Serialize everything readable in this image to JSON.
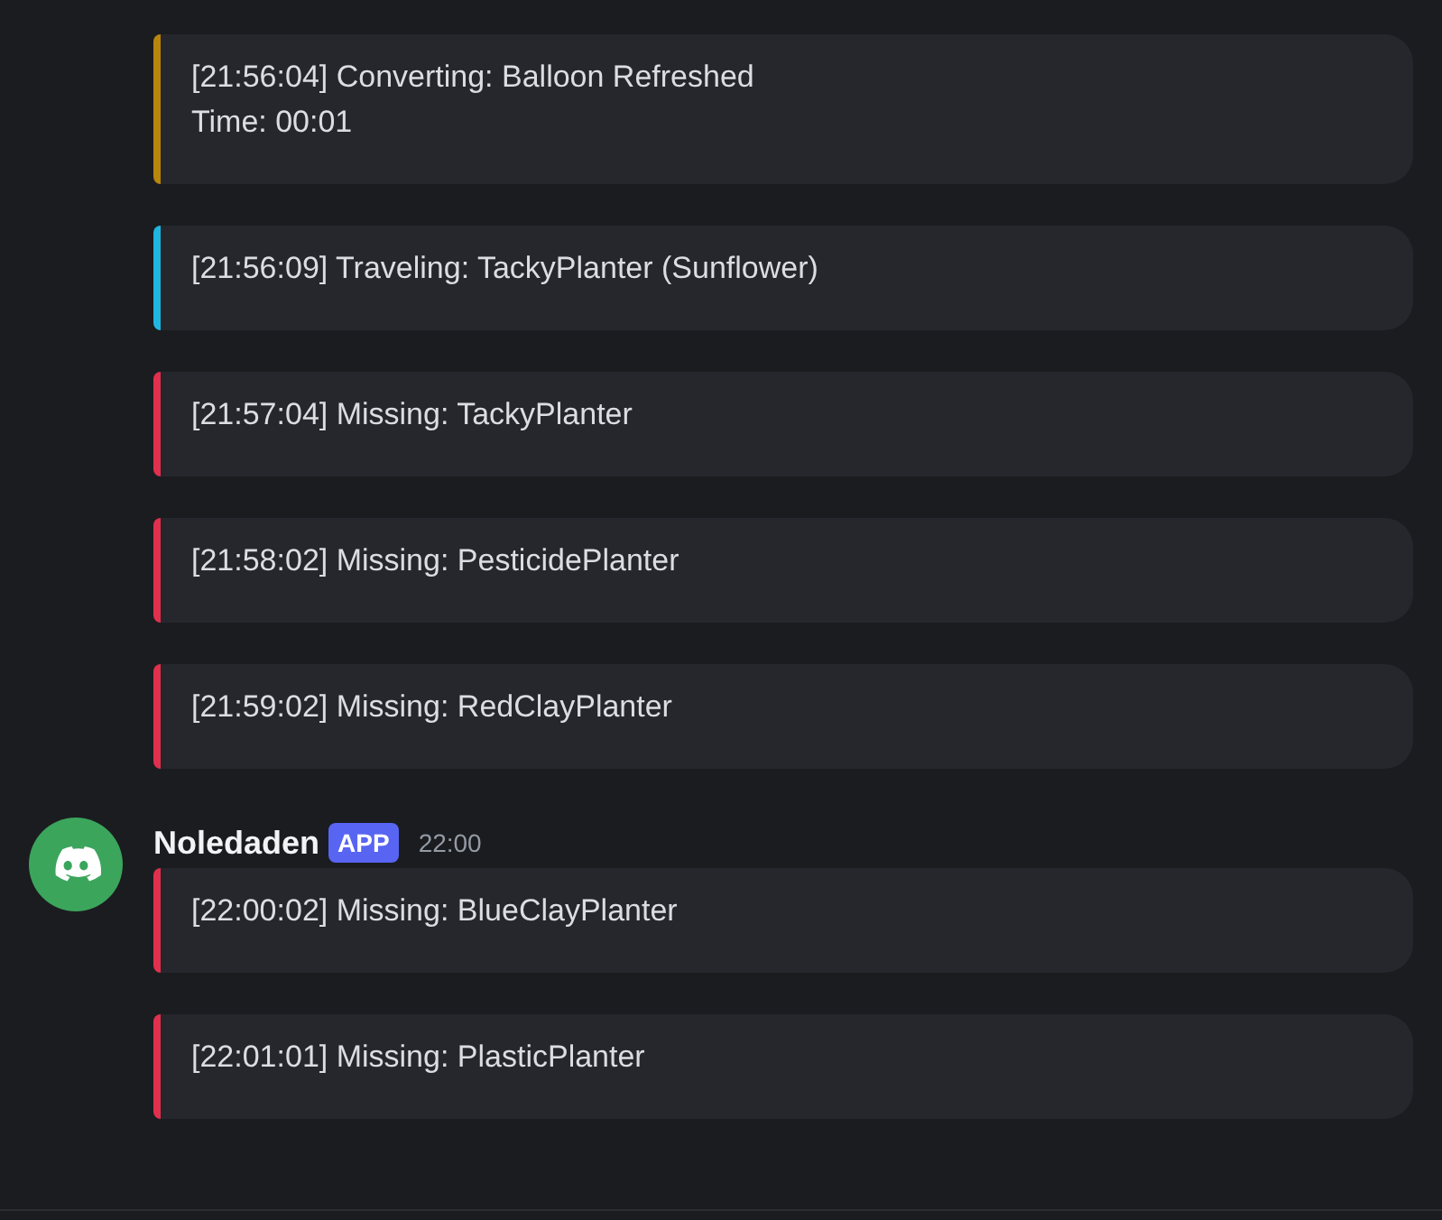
{
  "groups": [
    {
      "embeds": [
        {
          "color": "#b8860b",
          "lines": [
            "[21:56:04] Converting: Balloon Refreshed",
            "Time: 00:01"
          ]
        },
        {
          "color": "#1fb6e0",
          "lines": [
            "[21:56:09] Traveling: TackyPlanter (Sunflower)"
          ]
        },
        {
          "color": "#e0304e",
          "lines": [
            "[21:57:04] Missing: TackyPlanter"
          ]
        },
        {
          "color": "#e0304e",
          "lines": [
            "[21:58:02] Missing: PesticidePlanter"
          ]
        },
        {
          "color": "#e0304e",
          "lines": [
            "[21:59:02] Missing: RedClayPlanter"
          ]
        }
      ]
    },
    {
      "author": {
        "name": "Noledaden",
        "badge": "APP",
        "time": "22:00"
      },
      "embeds": [
        {
          "color": "#e0304e",
          "lines": [
            "[22:00:02] Missing: BlueClayPlanter"
          ]
        },
        {
          "color": "#e0304e",
          "lines": [
            "[22:01:01] Missing: PlasticPlanter"
          ]
        }
      ]
    }
  ]
}
